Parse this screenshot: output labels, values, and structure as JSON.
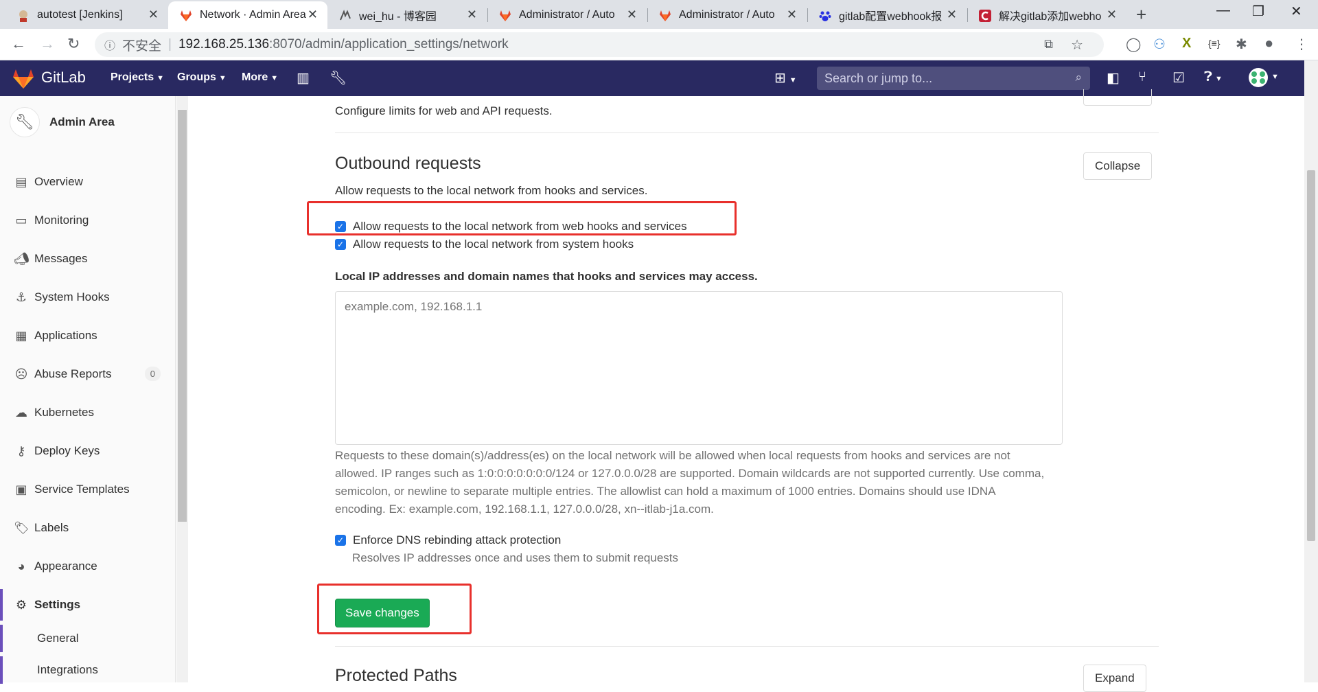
{
  "browser": {
    "tabs": [
      {
        "title": "autotest [Jenkins]",
        "icon": "jenkins-icon"
      },
      {
        "title": "Network · Admin Area",
        "icon": "gitlab-icon",
        "active": true
      },
      {
        "title": "wei_hu - 博客园",
        "icon": "cnblogs-icon"
      },
      {
        "title": "Administrator / Auto",
        "icon": "gitlab-icon"
      },
      {
        "title": "Administrator / Auto",
        "icon": "gitlab-icon"
      },
      {
        "title": "gitlab配置webhook报",
        "icon": "baidu-icon"
      },
      {
        "title": "解决gitlab添加webho",
        "icon": "csdn-icon"
      }
    ],
    "insecure_label": "不安全",
    "url_host": "192.168.25.136",
    "url_path": ":8070/admin/application_settings/network"
  },
  "header": {
    "brand": "GitLab",
    "nav": [
      "Projects",
      "Groups",
      "More"
    ],
    "search_placeholder": "Search or jump to..."
  },
  "sidebar": {
    "title": "Admin Area",
    "items": [
      {
        "label": "Overview",
        "icon": "overview-icon"
      },
      {
        "label": "Monitoring",
        "icon": "monitor-icon"
      },
      {
        "label": "Messages",
        "icon": "megaphone-icon"
      },
      {
        "label": "System Hooks",
        "icon": "hook-icon"
      },
      {
        "label": "Applications",
        "icon": "applications-icon"
      },
      {
        "label": "Abuse Reports",
        "icon": "sad-face-icon",
        "badge": "0"
      },
      {
        "label": "Kubernetes",
        "icon": "cloud-gear-icon"
      },
      {
        "label": "Deploy Keys",
        "icon": "key-icon"
      },
      {
        "label": "Service Templates",
        "icon": "template-icon"
      },
      {
        "label": "Labels",
        "icon": "label-icon"
      },
      {
        "label": "Appearance",
        "icon": "palette-icon"
      },
      {
        "label": "Settings",
        "icon": "gear-icon",
        "active": true
      }
    ],
    "subitems": [
      "General",
      "Integrations"
    ]
  },
  "main": {
    "top_description": "Configure limits for web and API requests.",
    "outbound": {
      "title": "Outbound requests",
      "button": "Collapse",
      "description": "Allow requests to the local network from hooks and services.",
      "checkbox_web_hooks": "Allow requests to the local network from web hooks and services",
      "checkbox_system_hooks": "Allow requests to the local network from system hooks",
      "allowlist_label": "Local IP addresses and domain names that hooks and services may access.",
      "allowlist_placeholder": "example.com, 192.168.1.1",
      "allowlist_help_1": "Requests to these domain(s)/address(es) on the local network will be allowed when local requests from hooks and services are not",
      "allowlist_help_2": "allowed. IP ranges such as 1:0:0:0:0:0:0:0/124 or 127.0.0.0/28 are supported. Domain wildcards are not supported currently. Use comma,",
      "allowlist_help_3": "semicolon, or newline to separate multiple entries. The allowlist can hold a maximum of 1000 entries. Domains should use IDNA",
      "allowlist_help_4": "encoding. Ex: example.com, 192.168.1.1, 127.0.0.0/28, xn--itlab-j1a.com.",
      "dns_checkbox": "Enforce DNS rebinding attack protection",
      "dns_help": "Resolves IP addresses once and uses them to submit requests",
      "save_button": "Save changes"
    },
    "protected": {
      "title": "Protected Paths",
      "button": "Expand"
    }
  },
  "colors": {
    "gitlab_header": "#292961",
    "save_green": "#1aaa55",
    "highlight_red": "#e8302c",
    "checkbox_blue": "#1a73e8"
  }
}
